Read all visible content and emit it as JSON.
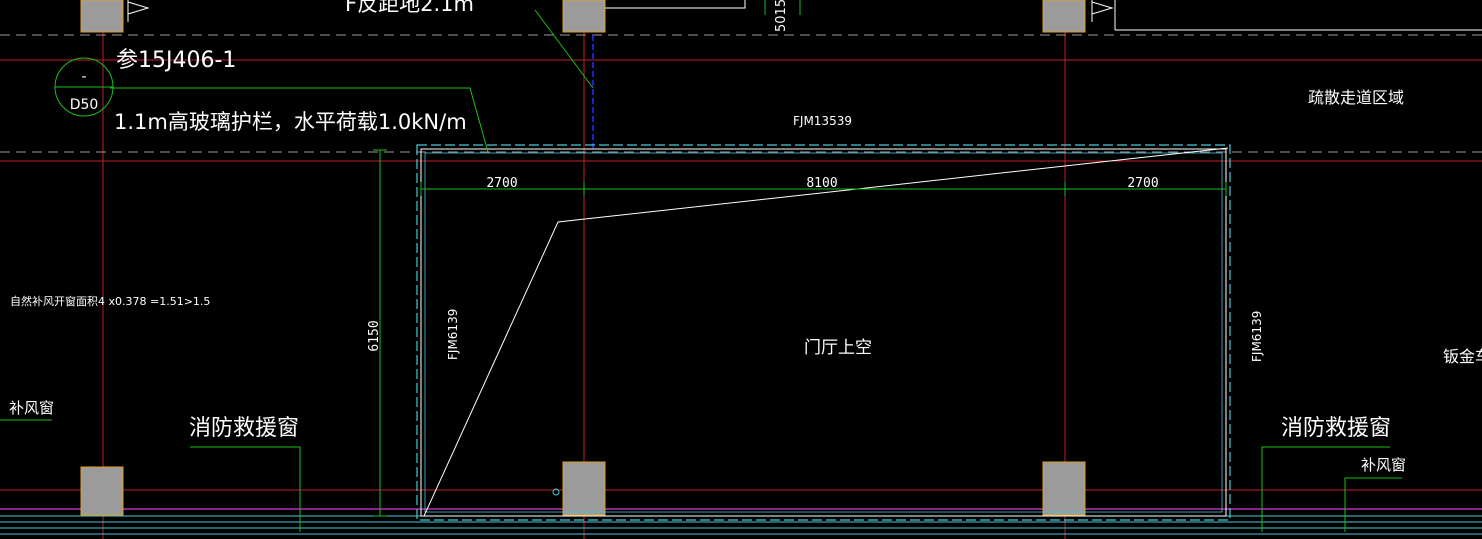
{
  "canvas": {
    "background": "#000000",
    "colors": {
      "grid_red": "#c0202a",
      "dash_gray": "#9a9a9a",
      "green": "#18c018",
      "cyan": "#49c9d8",
      "blue": "#2a2aff",
      "magenta": "#b62fb6",
      "white": "#ffffff",
      "column_fill": "#9b9b9b",
      "column_edge": "#e0a020"
    }
  },
  "annotations": {
    "top_partial_text": "F反距地2.1m",
    "ref_standard": "参15J406-1",
    "railing_note": "1.1m高玻璃护栏，水平荷载1.0kN/m",
    "detail_marker_top": "-",
    "detail_marker_bottom": "D50",
    "evac_zone": "疏散走道区域",
    "top_dim_partial": "5015",
    "door_top": "FJM13539",
    "door_left": "FJM6139",
    "door_right": "FJM6139",
    "vent_calc": "自然补风开窗面积4 x0.378 =1.51>1.5",
    "makeup_window_left": "补风窗",
    "makeup_window_right": "补风窗",
    "fire_rescue_left": "消防救援窗",
    "fire_rescue_right": "消防救援窗",
    "lobby_void": "门厅上空",
    "right_edge_partial": "钣金车"
  },
  "dimensions": {
    "seg_left": "2700",
    "seg_mid": "8100",
    "seg_right": "2700",
    "height": "6150"
  }
}
